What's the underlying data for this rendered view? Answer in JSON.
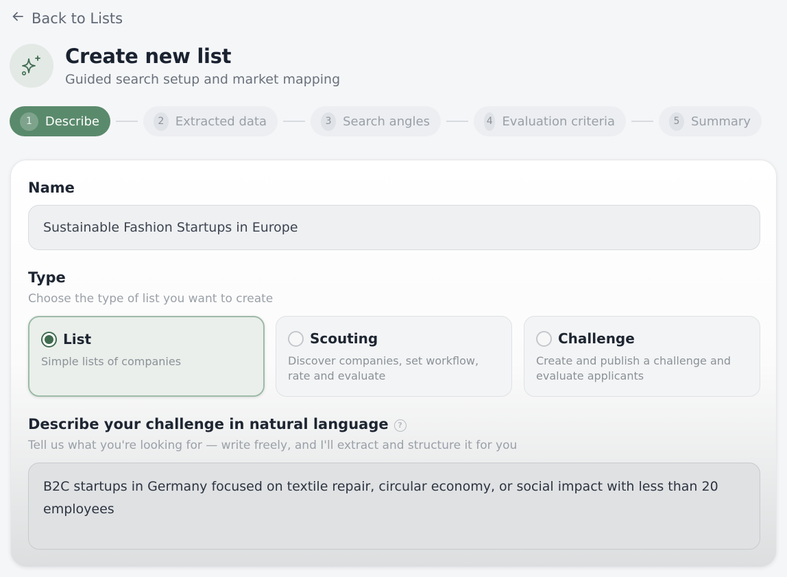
{
  "nav": {
    "back_label": "Back to Lists"
  },
  "header": {
    "icon": "sparkles-icon",
    "title": "Create new list",
    "subtitle": "Guided search setup and market mapping"
  },
  "stepper": {
    "steps": [
      {
        "num": "1",
        "label": "Describe",
        "active": true
      },
      {
        "num": "2",
        "label": "Extracted data",
        "active": false
      },
      {
        "num": "3",
        "label": "Search angles",
        "active": false
      },
      {
        "num": "4",
        "label": "Evaluation criteria",
        "active": false
      },
      {
        "num": "5",
        "label": "Summary",
        "active": false
      }
    ]
  },
  "form": {
    "name": {
      "label": "Name",
      "value": "Sustainable Fashion Startups in Europe"
    },
    "type": {
      "label": "Type",
      "help": "Choose the type of list you want to create",
      "selected": "List",
      "options": [
        {
          "title": "List",
          "desc": "Simple lists of companies"
        },
        {
          "title": "Scouting",
          "desc": "Discover companies, set workflow, rate and evaluate"
        },
        {
          "title": "Challenge",
          "desc": "Create and publish a challenge and evaluate applicants"
        }
      ]
    },
    "description": {
      "label": "Describe your challenge in natural language",
      "help_icon": "question-icon",
      "help": "Tell us what you're looking for — write freely, and I'll extract and structure it for you",
      "value": "B2C startups in Germany focused on textile repair, circular economy, or social impact with less than 20 employees"
    }
  },
  "colors": {
    "accent": "#5a8a6c",
    "accent_dark": "#3f6b4e",
    "page_bg": "#f5f6f8"
  }
}
